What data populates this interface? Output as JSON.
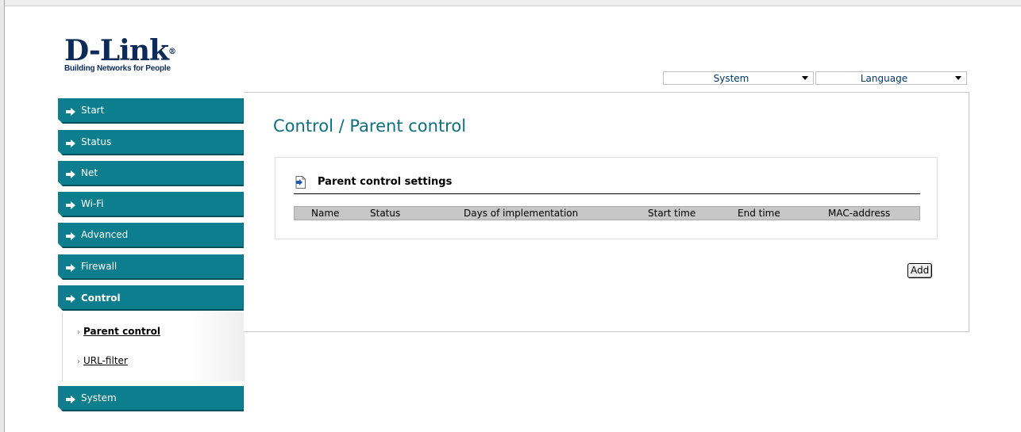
{
  "logo": {
    "name": "D-Link",
    "reg": "®",
    "tagline": "Building Networks for People"
  },
  "top_selectors": [
    {
      "label": "System"
    },
    {
      "label": "Language"
    }
  ],
  "menu": {
    "items": [
      {
        "label": "Start"
      },
      {
        "label": "Status"
      },
      {
        "label": "Net"
      },
      {
        "label": "Wi-Fi"
      },
      {
        "label": "Advanced"
      },
      {
        "label": "Firewall"
      },
      {
        "label": "Control",
        "active": true
      },
      {
        "label": "System"
      }
    ],
    "submenu": [
      {
        "label": "Parent control",
        "active": true
      },
      {
        "label": "URL-filter"
      }
    ]
  },
  "page": {
    "title": "Control /  Parent control",
    "section_title": "Parent control settings",
    "columns": [
      "Name",
      "Status",
      "Days of implementation",
      "Start time",
      "End time",
      "MAC-address"
    ],
    "rows": [],
    "add_button": "Add"
  },
  "colors": {
    "menu_bg": "#0d7e8e",
    "title_color": "#0d6f80",
    "logo_color": "#0c2b5a",
    "table_header_bg": "#c7c7c7"
  }
}
